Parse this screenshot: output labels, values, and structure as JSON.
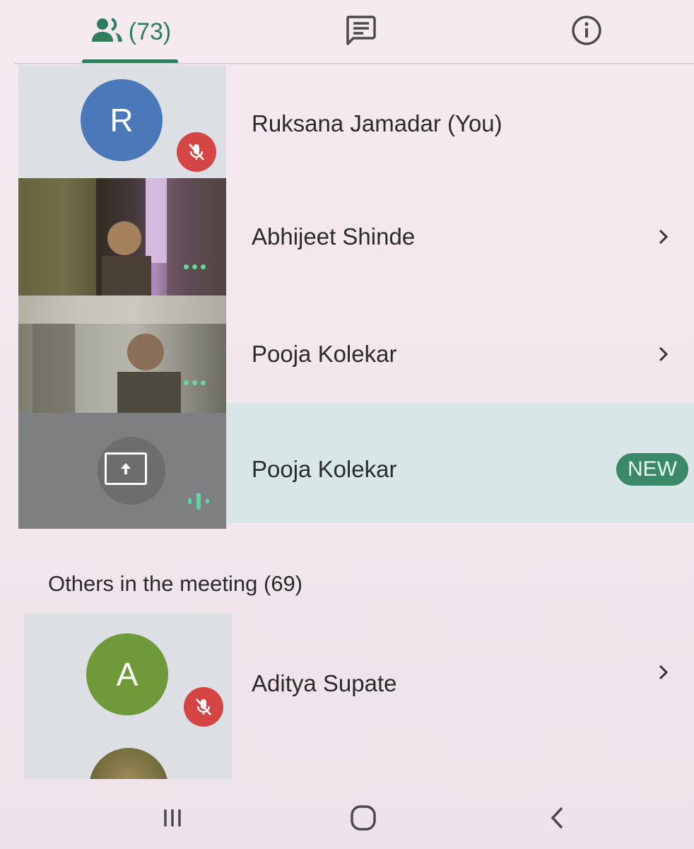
{
  "tabs": {
    "people_count": "(73)"
  },
  "participants": [
    {
      "name": "Ruksana Jamadar (You)",
      "avatar_letter": "R",
      "avatar_color": "#4a78b8",
      "muted": true
    },
    {
      "name": "Abhijeet Shinde"
    },
    {
      "name": "Pooja Kolekar"
    },
    {
      "name": "Pooja Kolekar",
      "badge": "NEW"
    }
  ],
  "others_section": {
    "title": "Others in the meeting (69)",
    "participants": [
      {
        "name": "Aditya Supate",
        "avatar_letter": "A",
        "avatar_color": "#6f9a3a",
        "muted": true
      }
    ]
  },
  "colors": {
    "accent": "#2f7d5c",
    "mute_red": "#d64545",
    "highlight_row": "#d8e6e8"
  },
  "icons": {
    "people": "people-icon",
    "chat": "chat-icon",
    "info": "info-icon",
    "chevron": "chevron-right-icon",
    "present": "present-screen-icon",
    "mic_off": "mic-off-icon"
  }
}
